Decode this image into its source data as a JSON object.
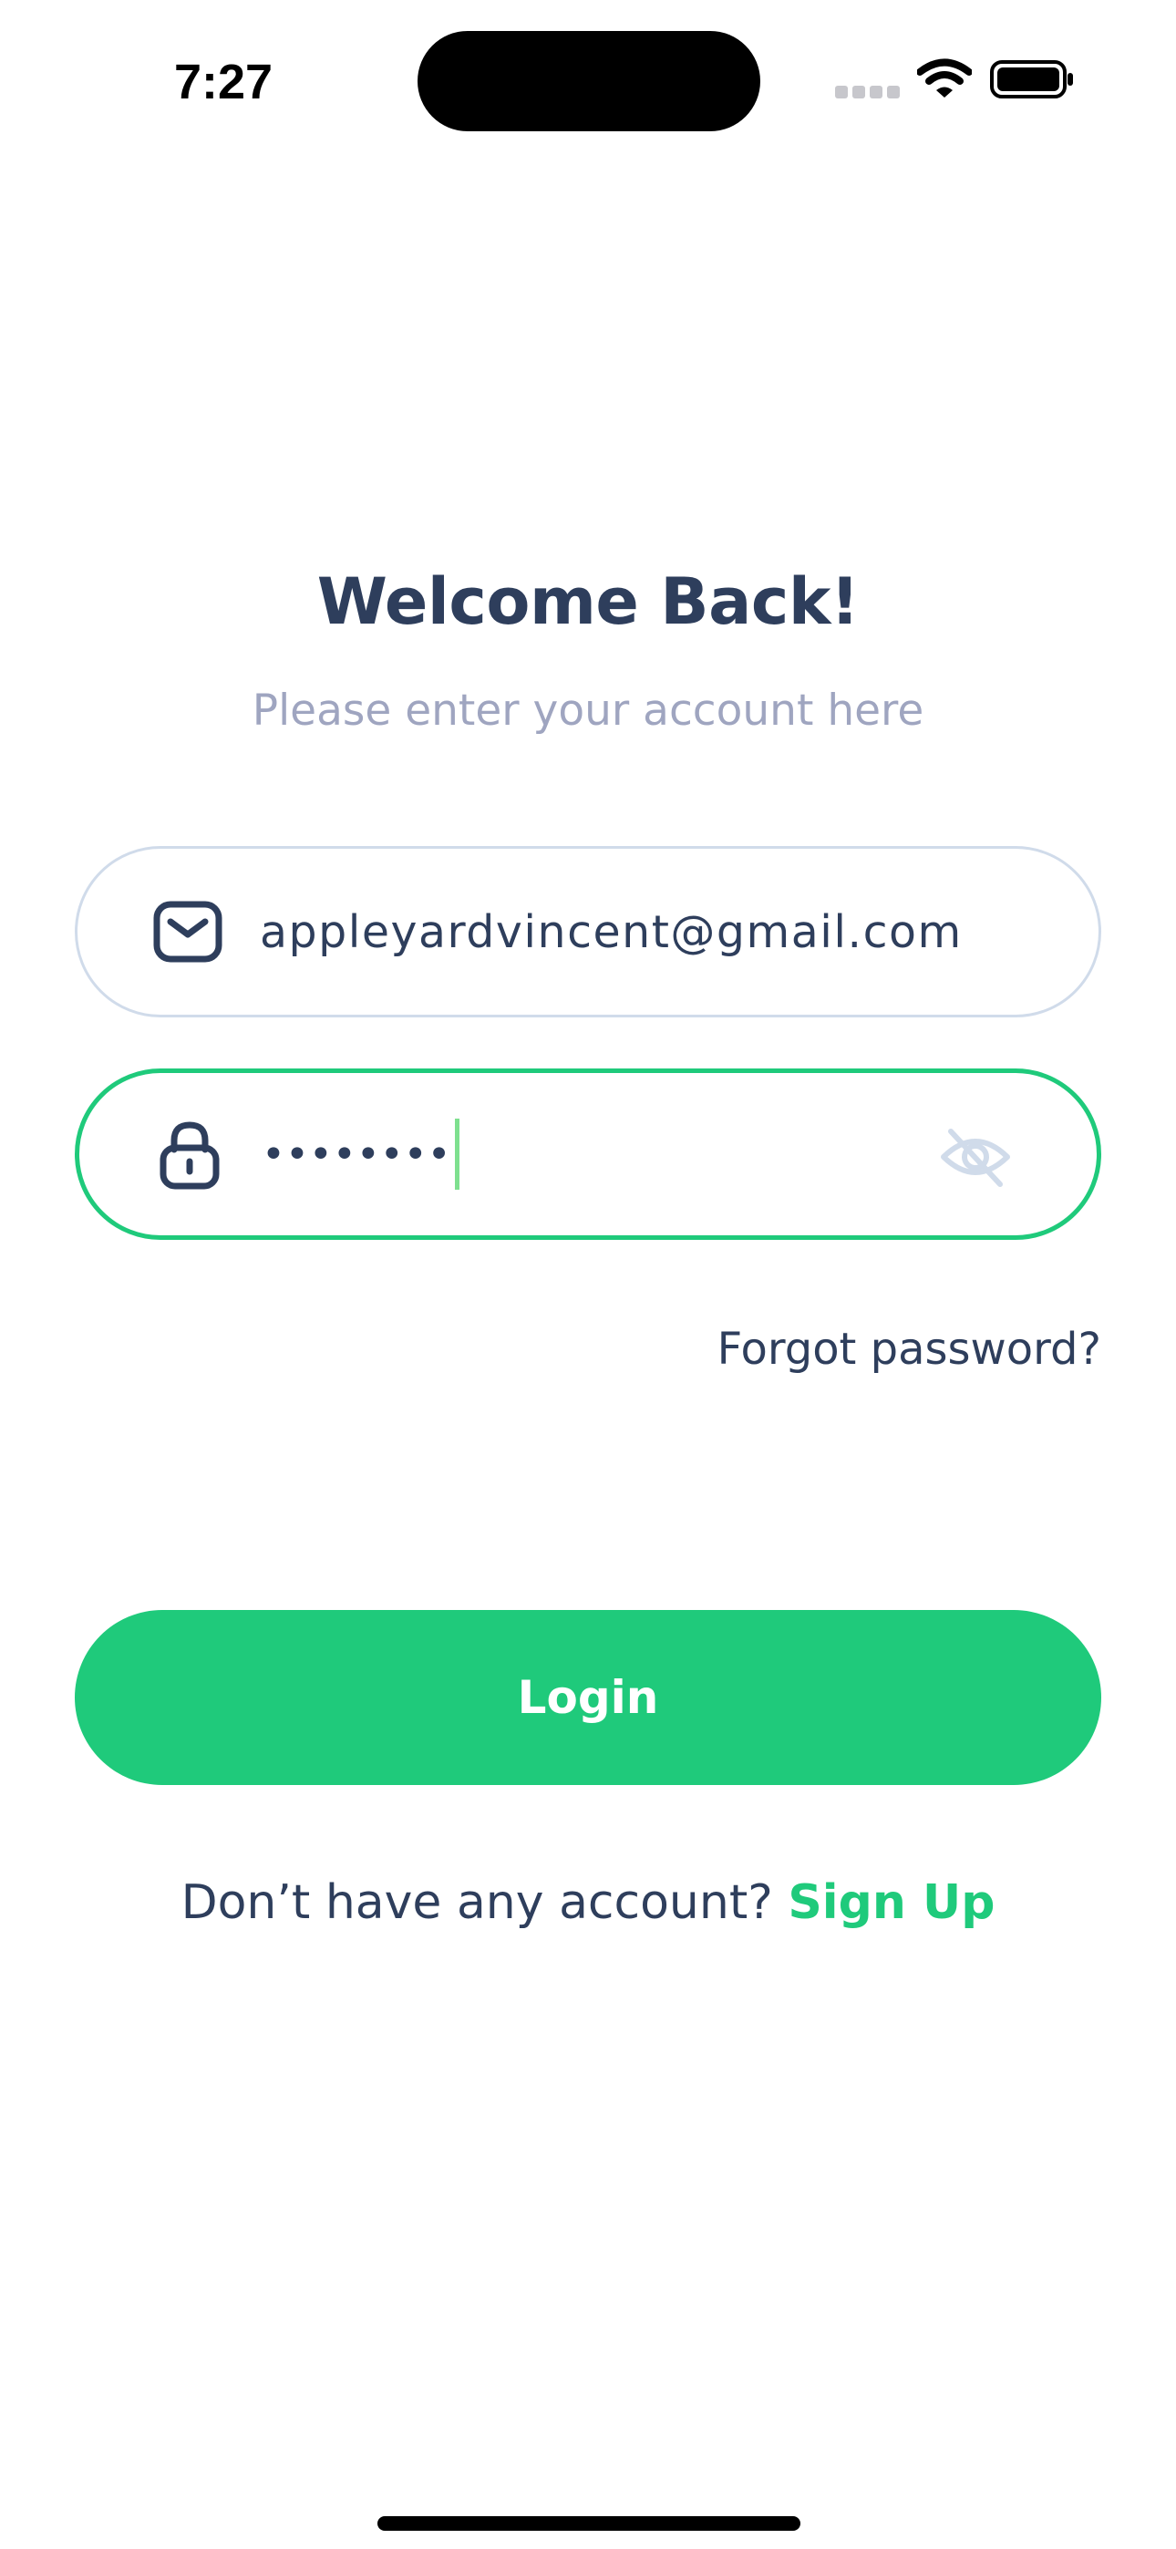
{
  "status_bar": {
    "time": "7:27",
    "icons": [
      "signal-icon",
      "wifi-icon",
      "battery-icon"
    ]
  },
  "header": {
    "title": "Welcome Back!",
    "subtitle": "Please enter your account here"
  },
  "form": {
    "email": {
      "icon": "mail-icon",
      "value": "appleyardvincent@gmail.com"
    },
    "password": {
      "icon": "lock-icon",
      "value": "••••••••",
      "visibility_icon": "eye-off-icon",
      "focused": true
    },
    "forgot_label": "Forgot password?",
    "login_label": "Login"
  },
  "footer": {
    "prompt": "Don’t have any account?",
    "signup_label": "Sign Up"
  },
  "colors": {
    "accent": "#1fca7b",
    "text_primary": "#2e3e5c",
    "text_secondary": "#9fa5c0",
    "input_border": "#d0dbea"
  }
}
